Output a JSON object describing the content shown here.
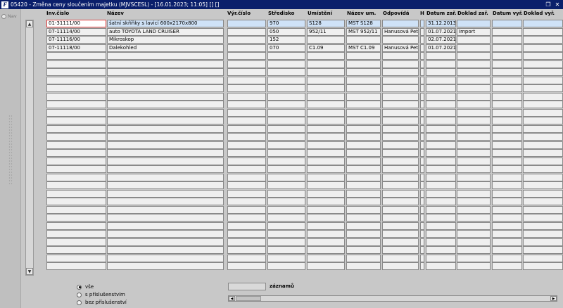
{
  "window": {
    "title": "05420 - Změna ceny sloučením majetku (MJVSCESL) - [16.01.2023; 11:05] [] []",
    "app_icon": "F",
    "restore_icon": "restore-icon"
  },
  "nav": {
    "label": "Nav",
    "icon": "nav-icon"
  },
  "columns": [
    {
      "key": "inv",
      "label": "Inv.číslo"
    },
    {
      "key": "nazev",
      "label": "Název"
    },
    {
      "key": "vyr",
      "label": "Výr.číslo"
    },
    {
      "key": "str",
      "label": "Středisko"
    },
    {
      "key": "umi",
      "label": "Umístění"
    },
    {
      "key": "num",
      "label": "Název um."
    },
    {
      "key": "odp",
      "label": "Odpovídá"
    },
    {
      "key": "h",
      "label": "H"
    },
    {
      "key": "dz",
      "label": "Datum zař."
    },
    {
      "key": "dkz",
      "label": "Doklad zař."
    },
    {
      "key": "dv",
      "label": "Datum vyř."
    },
    {
      "key": "dkv",
      "label": "Doklad vyř."
    }
  ],
  "rows": [
    {
      "inv": "01-31111/00",
      "nazev": "šatní skříňky s lavicí 600x2170x800",
      "vyr": "",
      "str": "970",
      "umi": "S128",
      "num": "MST S128",
      "odp": "",
      "h": "",
      "dz": "31.12.2013",
      "dkz": "",
      "dv": "",
      "dkv": ""
    },
    {
      "inv": "07-11114/00",
      "nazev": "auto TOYOTA LAND CRUISER",
      "vyr": "",
      "str": "050",
      "umi": "952/11",
      "num": "MST 952/11",
      "odp": "Hanusová Petr",
      "h": "",
      "dz": "01.07.2021",
      "dkz": "Import",
      "dv": "",
      "dkv": ""
    },
    {
      "inv": "07-11116/00",
      "nazev": "Mikroskop",
      "vyr": "",
      "str": "152",
      "umi": "",
      "num": "",
      "odp": "",
      "h": "",
      "dz": "02.07.2021",
      "dkz": "",
      "dv": "",
      "dkv": ""
    },
    {
      "inv": "07-11118/00",
      "nazev": "Dalekohled",
      "vyr": "",
      "str": "070",
      "umi": "C1.09",
      "num": "MST C1.09",
      "odp": "Hanusová Petr",
      "h": "",
      "dz": "01.07.2021",
      "dkz": "",
      "dv": "",
      "dkv": ""
    }
  ],
  "footer": {
    "filter_options": [
      {
        "label": "vše",
        "checked": true
      },
      {
        "label": "s příslušenstvím",
        "checked": false
      },
      {
        "label": "bez příslušenství",
        "checked": false
      }
    ],
    "count_value": "",
    "count_label": "záznamů"
  }
}
